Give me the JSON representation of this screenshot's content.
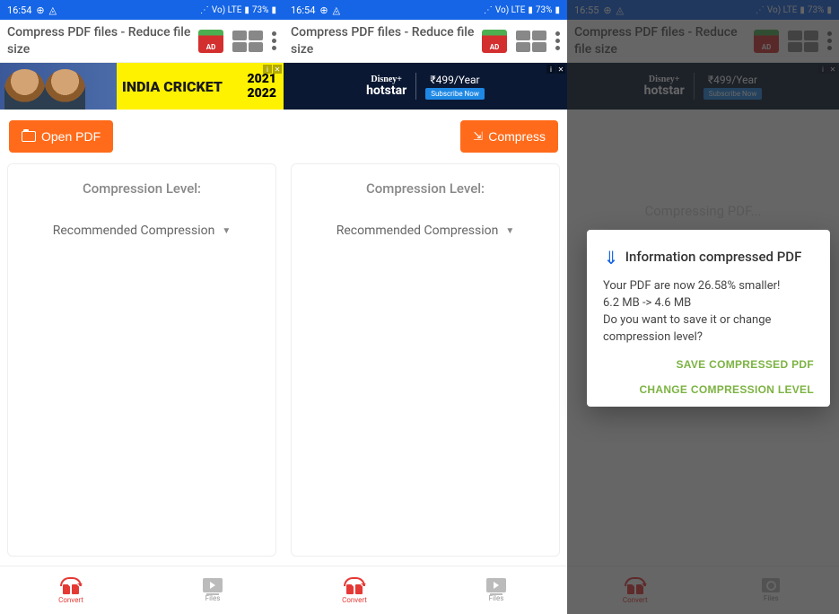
{
  "status": {
    "time1": "16:54",
    "time2": "16:54",
    "time3": "16:55",
    "battery": "73%",
    "network": "Vo) LTE"
  },
  "app": {
    "title": "Compress PDF files - Reduce file size"
  },
  "ads": {
    "cricket": {
      "line1": "INDIA",
      "line2": "CRICKET",
      "year_top": "2021",
      "year_bot": "2022"
    },
    "hotstar": {
      "brand_top": "Disney+",
      "brand": "hotstar",
      "price": "₹499/Year",
      "cta": "Subscribe Now"
    }
  },
  "actions": {
    "open_label": "Open PDF",
    "compress_label": "Compress"
  },
  "panel": {
    "title": "Compression Level:",
    "select_value": "Recommended Compression"
  },
  "nav": {
    "convert": "Convert",
    "files": "Files"
  },
  "processing": "Compressing PDF...",
  "dialog": {
    "title": "Information compressed PDF",
    "line1": "Your PDF are now 26.58% smaller!",
    "line2": "6.2 MB -> 4.6 MB",
    "line3": "Do you want to save it or change compression level?",
    "save": "SAVE COMPRESSED PDF",
    "change": "CHANGE COMPRESSION LEVEL"
  }
}
